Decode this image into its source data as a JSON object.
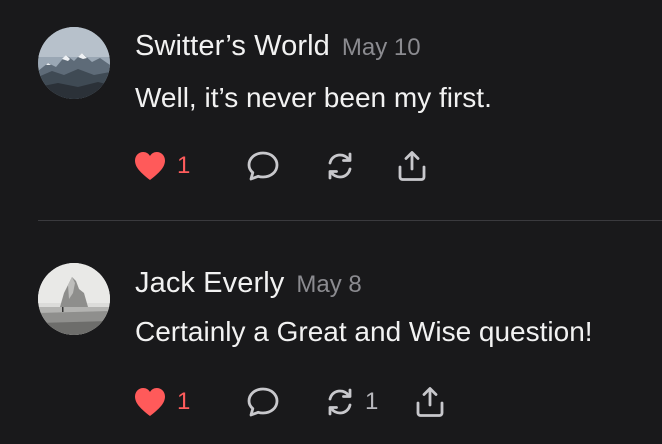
{
  "colors": {
    "background": "#19191b",
    "text": "#f2f2f2",
    "muted": "#8b8b90",
    "like": "#ff5a5a",
    "icon": "#c8c8cc"
  },
  "comments": [
    {
      "author": "Switter’s World",
      "date": "May 10",
      "text": "Well, it’s never been my first.",
      "likes": "1",
      "liked": true,
      "restacks": "",
      "icons": [
        "heart-icon",
        "comment-bubble-icon",
        "restack-icon",
        "share-icon"
      ]
    },
    {
      "author": "Jack Everly",
      "date": "May 8",
      "text": "Certainly a Great and Wise question!",
      "likes": "1",
      "liked": true,
      "restacks": "1",
      "icons": [
        "heart-icon",
        "comment-bubble-icon",
        "restack-icon",
        "share-icon"
      ]
    }
  ]
}
